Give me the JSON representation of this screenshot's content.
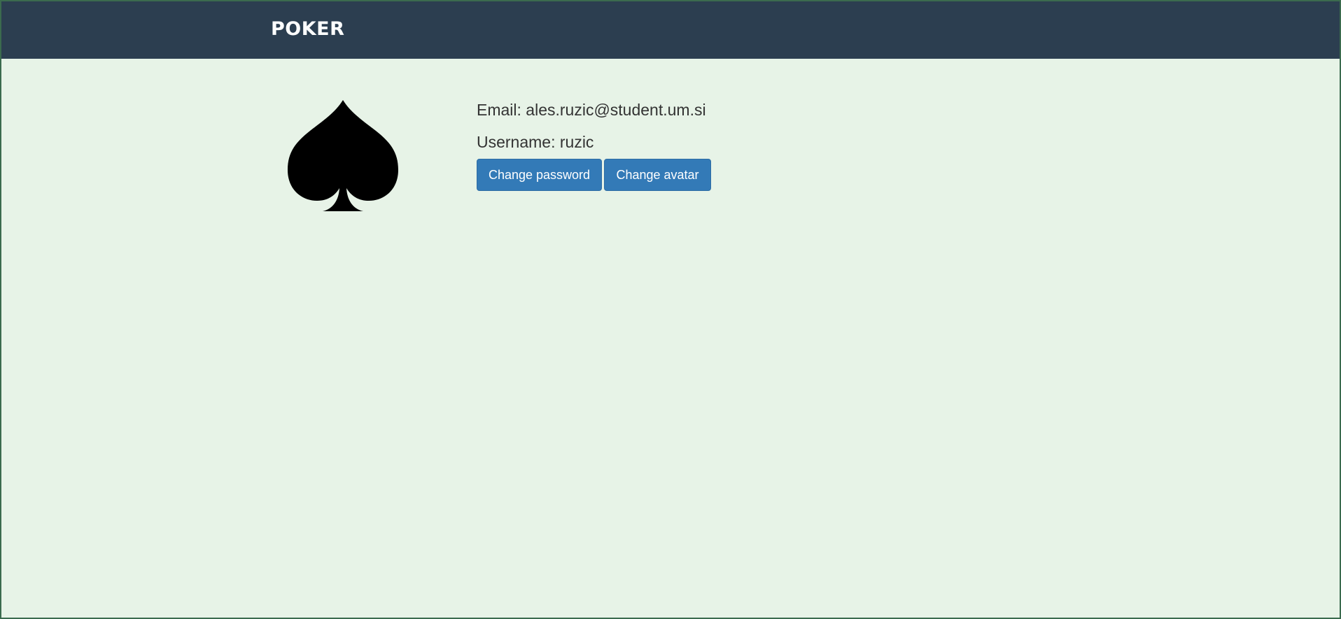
{
  "navbar": {
    "brand": "POKER",
    "background_color": "#2c3e50"
  },
  "profile": {
    "avatar_icon": "spade-icon",
    "email_label": "Email:",
    "email": "ales.ruzic@student.um.si",
    "username_label": "Username:",
    "username": "ruzic"
  },
  "actions": {
    "change_password_label": "Change password",
    "change_avatar_label": "Change avatar",
    "button_color": "#337ab7"
  },
  "page": {
    "background_color": "#e7f3e7"
  }
}
